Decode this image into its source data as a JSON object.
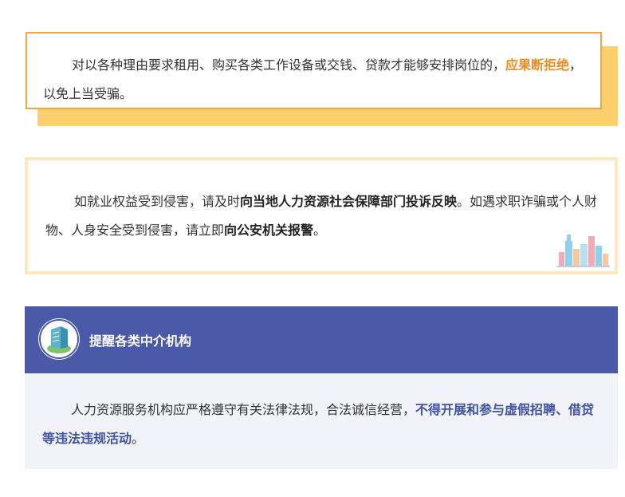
{
  "card1": {
    "text_plain": "对以各种理由要求租用、购买各类工作设备或交钱、贷款才能够安排岗位的，",
    "text_highlight": "应果断拒绝",
    "text_end": "，以免上当受骗。",
    "accent_color": "#f4a63b",
    "shadow_color": "#fdd06e"
  },
  "card2": {
    "text_1": "如就业权益受到侵害，请及时",
    "bold_1": "向当地人力资源社会保障部门投诉反映",
    "text_2": "。如遇求职诈骗或个人财物、人身安全受到侵害，请立即",
    "bold_2": "向公安机关报警",
    "text_3": "。",
    "border_color": "#fde8bf",
    "icon": "city-buildings-icon"
  },
  "card3": {
    "title": "提醒各类中介机构",
    "text_plain": "人力资源服务机构应严格遵守有关法律法规，合法诚信经营，",
    "text_highlight": "不得开展和参与虚假招聘、借贷等违法违规活动",
    "text_end": "。",
    "header_color": "#4a5aa8",
    "body_color": "#f2f3f8",
    "icon": "office-building-icon"
  }
}
